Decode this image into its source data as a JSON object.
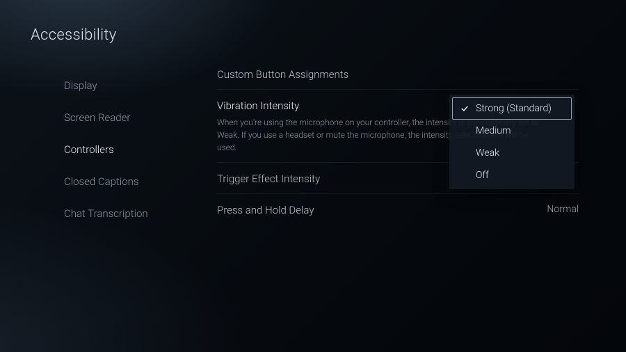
{
  "header": {
    "title": "Accessibility"
  },
  "sidebar": {
    "items": [
      {
        "label": "Display"
      },
      {
        "label": "Screen Reader"
      },
      {
        "label": "Controllers"
      },
      {
        "label": "Closed Captions"
      },
      {
        "label": "Chat Transcription"
      }
    ],
    "active_index": 2
  },
  "settings": [
    {
      "label": "Custom Button Assignments",
      "desc": "",
      "value": ""
    },
    {
      "label": "Vibration Intensity",
      "desc": "When you're using the microphone on your controller, the intensity is automatically set to Weak. If you use a headset or mute the microphone, the intensity selected here will be used.",
      "value": ""
    },
    {
      "label": "Trigger Effect Intensity",
      "desc": "",
      "value": ""
    },
    {
      "label": "Press and Hold Delay",
      "desc": "",
      "value": "Normal"
    }
  ],
  "dropdown": {
    "options": [
      {
        "label": "Strong (Standard)",
        "selected": true
      },
      {
        "label": "Medium",
        "selected": false
      },
      {
        "label": "Weak",
        "selected": false
      },
      {
        "label": "Off",
        "selected": false
      }
    ]
  }
}
